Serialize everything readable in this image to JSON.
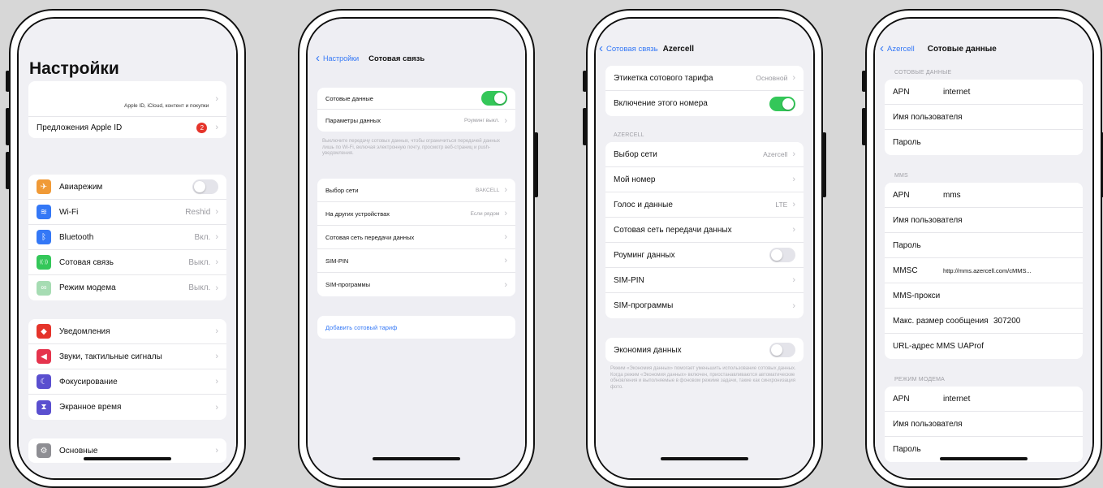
{
  "colors": {
    "accent": "#3478f6",
    "toggle_on": "#34c759",
    "background": "#f0f0f4"
  },
  "screen1": {
    "title": "Настройки",
    "apple_id_subtitle": "Apple ID, iCloud, контент и покупки",
    "apple_id_offers": "Предложения Apple ID",
    "apple_id_badge": "2",
    "group2": [
      {
        "label": "Авиарежим",
        "value": "",
        "icon": "airplane-icon",
        "color": "#f09a37",
        "glyph": "✈"
      },
      {
        "label": "Wi-Fi",
        "value": "Reshid",
        "icon": "wifi-icon",
        "color": "#3478f6",
        "glyph": "≋"
      },
      {
        "label": "Bluetooth",
        "value": "Вкл.",
        "icon": "bluetooth-icon",
        "color": "#3478f6",
        "glyph": "ᛒ"
      },
      {
        "label": "Сотовая связь",
        "value": "Выкл.",
        "icon": "antenna-icon",
        "color": "#34c759",
        "glyph": "((·))"
      },
      {
        "label": "Режим модема",
        "value": "Выкл.",
        "icon": "hotspot-icon",
        "color": "#a6dcb3",
        "glyph": "∞"
      }
    ],
    "group3": [
      {
        "label": "Уведомления",
        "icon": "bell-icon",
        "color": "#e5342b",
        "glyph": "◆"
      },
      {
        "label": "Звуки, тактильные сигналы",
        "icon": "speaker-icon",
        "color": "#e5344d",
        "glyph": "◀"
      },
      {
        "label": "Фокусирование",
        "icon": "moon-icon",
        "color": "#5a4fcf",
        "glyph": "☾"
      },
      {
        "label": "Экранное время",
        "icon": "hourglass-icon",
        "color": "#5a4fcf",
        "glyph": "⧗"
      }
    ],
    "group4": [
      {
        "label": "Основные",
        "icon": "gear-icon",
        "color": "#8e8e93",
        "glyph": "⚙"
      }
    ]
  },
  "screen2": {
    "back": "Настройки",
    "title": "Сотовая связь",
    "group1": [
      {
        "label": "Сотовые данные",
        "toggle": "on"
      },
      {
        "label": "Параметры данных",
        "value": "Роуминг выкл."
      }
    ],
    "footnote": "Выключите передачу сотовых данных, чтобы ограничиться передачей данных лишь по Wi-Fi, включая электронную почту, просмотр веб-страниц и push-уведомления.",
    "group2": [
      {
        "label": "Выбор сети",
        "value": "BAKCELL"
      },
      {
        "label": "На других устройствах",
        "value": "Если рядом"
      },
      {
        "label": "Сотовая сеть передачи данных",
        "value": ""
      },
      {
        "label": "SIM-PIN",
        "value": ""
      },
      {
        "label": "SIM-программы",
        "value": ""
      }
    ],
    "add_plan": "Добавить сотовый тариф"
  },
  "screen3": {
    "back": "Сотовая связь",
    "title": "Azercell",
    "group1": [
      {
        "label": "Этикетка сотового тарифа",
        "value": "Основной"
      },
      {
        "label": "Включение этого номера",
        "toggle": "on"
      }
    ],
    "section": "AZERCELL",
    "group2": [
      {
        "label": "Выбор сети",
        "value": "Azercell"
      },
      {
        "label": "Мой номер",
        "value": ""
      },
      {
        "label": "Голос и данные",
        "value": "LTE"
      },
      {
        "label": "Сотовая сеть передачи данных",
        "value": ""
      },
      {
        "label": "Роуминг данных",
        "toggle": "off"
      },
      {
        "label": "SIM-PIN",
        "value": ""
      },
      {
        "label": "SIM-программы",
        "value": ""
      }
    ],
    "group3": [
      {
        "label": "Экономия данных",
        "toggle": "off"
      }
    ],
    "footnote": "Режим «Экономия данных» помогает уменьшить использование сотовых данных. Когда режим «Экономия данных» включен, приостанавливаются автоматические обновления и выполняемые в фоновом режиме задачи, такие как синхронизация фото."
  },
  "screen4": {
    "back": "Azercell",
    "title": "Сотовые данные",
    "section1": "СОТОВЫЕ ДАННЫЕ",
    "group1": [
      {
        "label": "APN",
        "value": "internet"
      },
      {
        "label": "Имя пользователя",
        "value": ""
      },
      {
        "label": "Пароль",
        "value": ""
      }
    ],
    "section2": "MMS",
    "group2": [
      {
        "label": "APN",
        "value": "mms"
      },
      {
        "label": "Имя пользователя",
        "value": ""
      },
      {
        "label": "Пароль",
        "value": ""
      },
      {
        "label": "MMSC",
        "value": "http://mms.azercell.com/cMMS..."
      },
      {
        "label": "MMS-прокси",
        "value": ""
      },
      {
        "label": "Макс. размер сообщения",
        "value": "307200"
      },
      {
        "label": "URL-адрес MMS UAProf",
        "value": ""
      }
    ],
    "section3": "РЕЖИМ МОДЕМА",
    "group3": [
      {
        "label": "APN",
        "value": "internet"
      },
      {
        "label": "Имя пользователя",
        "value": ""
      },
      {
        "label": "Пароль",
        "value": ""
      }
    ]
  }
}
